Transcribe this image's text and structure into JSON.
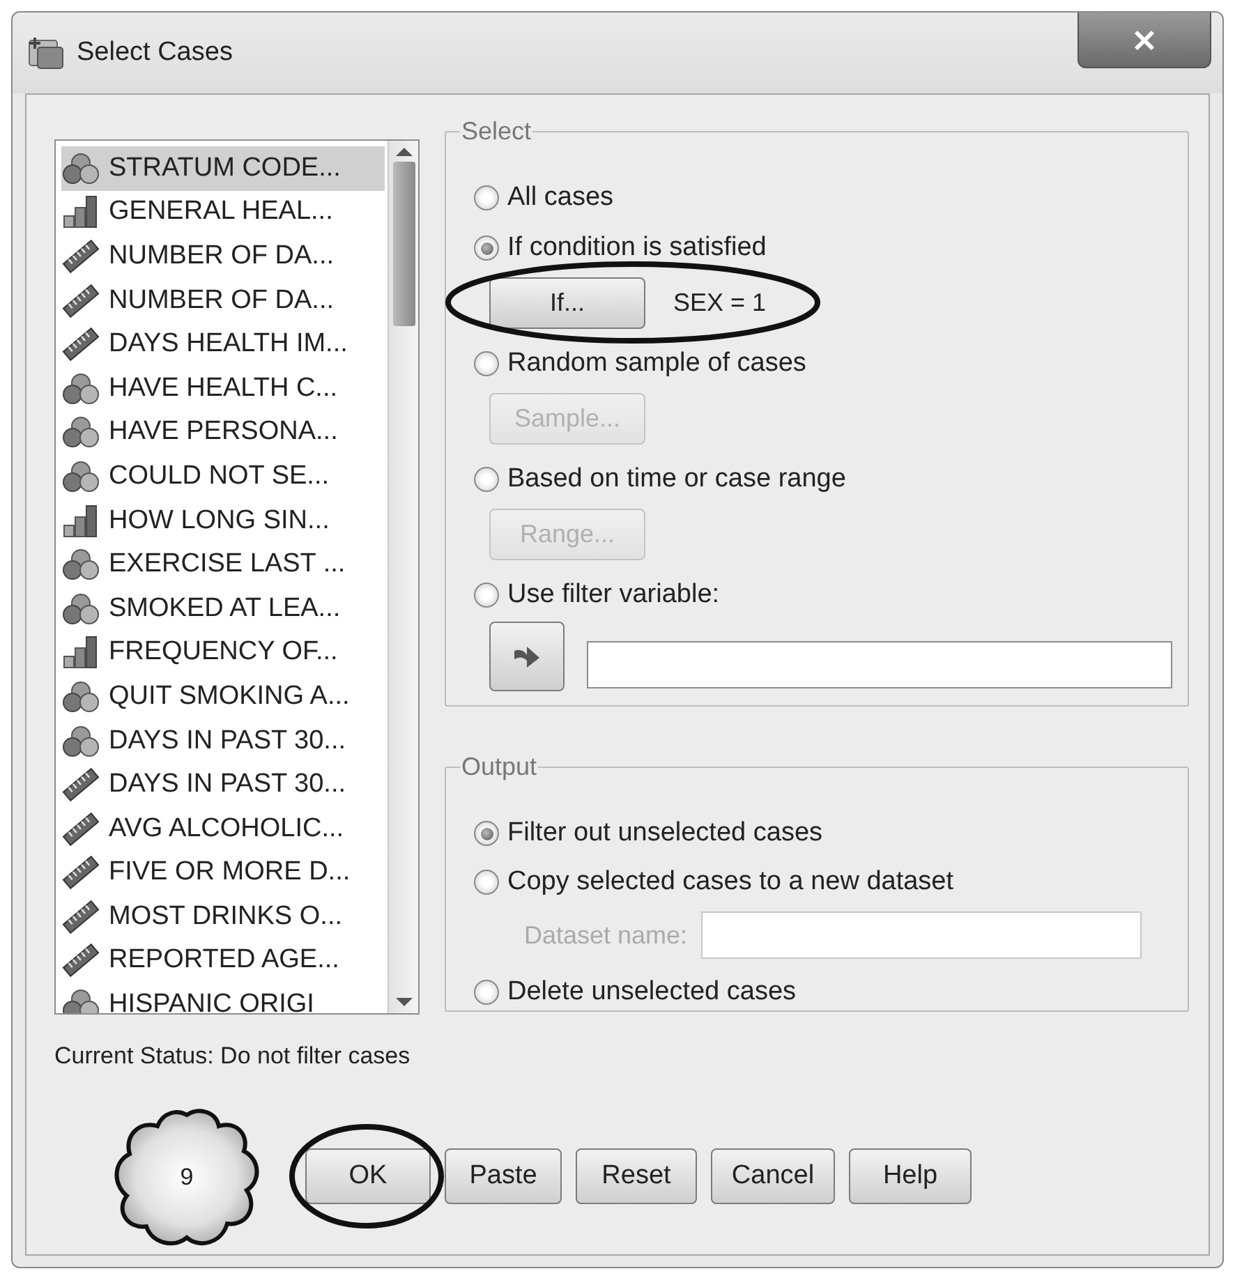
{
  "window": {
    "title": "Select Cases"
  },
  "variables": [
    {
      "label": "STRATUM CODE...",
      "kind": "nominal",
      "selected": true
    },
    {
      "label": "GENERAL HEAL...",
      "kind": "ordinal",
      "selected": false
    },
    {
      "label": "NUMBER OF DA...",
      "kind": "scale",
      "selected": false
    },
    {
      "label": "NUMBER OF DA...",
      "kind": "scale",
      "selected": false
    },
    {
      "label": "DAYS HEALTH IM...",
      "kind": "scale",
      "selected": false
    },
    {
      "label": "HAVE HEALTH C...",
      "kind": "nominal",
      "selected": false
    },
    {
      "label": "HAVE PERSONA...",
      "kind": "nominal",
      "selected": false
    },
    {
      "label": "COULD NOT SE...",
      "kind": "nominal",
      "selected": false
    },
    {
      "label": "HOW LONG SIN...",
      "kind": "ordinal",
      "selected": false
    },
    {
      "label": "EXERCISE LAST ...",
      "kind": "nominal",
      "selected": false
    },
    {
      "label": "SMOKED AT LEA...",
      "kind": "nominal",
      "selected": false
    },
    {
      "label": "FREQUENCY OF...",
      "kind": "ordinal",
      "selected": false
    },
    {
      "label": "QUIT SMOKING A...",
      "kind": "nominal",
      "selected": false
    },
    {
      "label": "DAYS IN PAST 30...",
      "kind": "nominal",
      "selected": false
    },
    {
      "label": "DAYS IN PAST 30...",
      "kind": "scale",
      "selected": false
    },
    {
      "label": "AVG ALCOHOLIC...",
      "kind": "scale",
      "selected": false
    },
    {
      "label": "FIVE OR MORE D...",
      "kind": "scale",
      "selected": false
    },
    {
      "label": "MOST DRINKS O...",
      "kind": "scale",
      "selected": false
    },
    {
      "label": "REPORTED AGE...",
      "kind": "scale",
      "selected": false
    },
    {
      "label": "HISPANIC ORIGI",
      "kind": "nominal",
      "selected": false
    }
  ],
  "select": {
    "title": "Select",
    "options": [
      {
        "kind": "plain",
        "label": "All cases",
        "selected": false
      },
      {
        "kind": "button",
        "label": "If condition is satisfied",
        "selected": true,
        "button": {
          "label": "If...",
          "disabled": false,
          "circled": true
        },
        "condition": "SEX = 1"
      },
      {
        "kind": "button",
        "label": "Random sample of cases",
        "selected": false,
        "button": {
          "label": "Sample...",
          "disabled": true,
          "circled": false
        }
      },
      {
        "kind": "button",
        "label": "Based on time or case range",
        "selected": false,
        "button": {
          "label": "Range...",
          "disabled": true,
          "circled": false
        }
      },
      {
        "kind": "filter",
        "label": "Use filter variable:",
        "selected": false
      }
    ]
  },
  "output": {
    "title": "Output",
    "options": [
      {
        "kind": "plain",
        "label": "Filter out unselected cases",
        "selected": true
      },
      {
        "kind": "dataset",
        "label": "Copy selected cases to a new dataset",
        "selected": false,
        "field": {
          "label": "Dataset name:",
          "disabled": true
        }
      },
      {
        "kind": "plain",
        "label": "Delete unselected cases",
        "selected": false
      }
    ]
  },
  "status": "Current Status: Do not filter cases",
  "buttons": [
    {
      "label": "OK",
      "circled": true
    },
    {
      "label": "Paste",
      "circled": false
    },
    {
      "label": "Reset",
      "circled": false
    },
    {
      "label": "Cancel",
      "circled": false
    },
    {
      "label": "Help",
      "circled": false
    }
  ],
  "step_badge": "9"
}
